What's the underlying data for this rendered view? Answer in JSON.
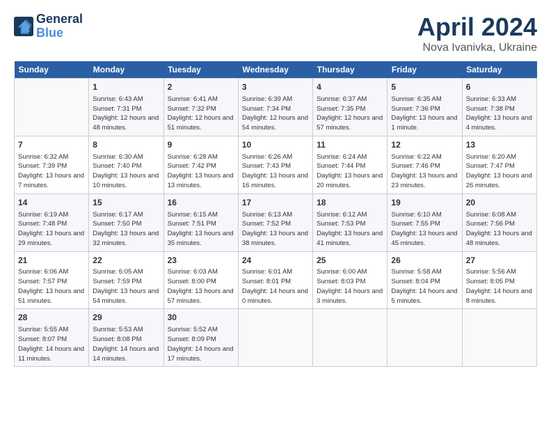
{
  "header": {
    "logo_line1": "General",
    "logo_line2": "Blue",
    "title": "April 2024",
    "subtitle": "Nova Ivanivka, Ukraine"
  },
  "days_of_week": [
    "Sunday",
    "Monday",
    "Tuesday",
    "Wednesday",
    "Thursday",
    "Friday",
    "Saturday"
  ],
  "weeks": [
    [
      {
        "day": "",
        "content": ""
      },
      {
        "day": "1",
        "content": "Sunrise: 6:43 AM\nSunset: 7:31 PM\nDaylight: 12 hours\nand 48 minutes."
      },
      {
        "day": "2",
        "content": "Sunrise: 6:41 AM\nSunset: 7:32 PM\nDaylight: 12 hours\nand 51 minutes."
      },
      {
        "day": "3",
        "content": "Sunrise: 6:39 AM\nSunset: 7:34 PM\nDaylight: 12 hours\nand 54 minutes."
      },
      {
        "day": "4",
        "content": "Sunrise: 6:37 AM\nSunset: 7:35 PM\nDaylight: 12 hours\nand 57 minutes."
      },
      {
        "day": "5",
        "content": "Sunrise: 6:35 AM\nSunset: 7:36 PM\nDaylight: 13 hours\nand 1 minute."
      },
      {
        "day": "6",
        "content": "Sunrise: 6:33 AM\nSunset: 7:38 PM\nDaylight: 13 hours\nand 4 minutes."
      }
    ],
    [
      {
        "day": "7",
        "content": "Sunrise: 6:32 AM\nSunset: 7:39 PM\nDaylight: 13 hours\nand 7 minutes."
      },
      {
        "day": "8",
        "content": "Sunrise: 6:30 AM\nSunset: 7:40 PM\nDaylight: 13 hours\nand 10 minutes."
      },
      {
        "day": "9",
        "content": "Sunrise: 6:28 AM\nSunset: 7:42 PM\nDaylight: 13 hours\nand 13 minutes."
      },
      {
        "day": "10",
        "content": "Sunrise: 6:26 AM\nSunset: 7:43 PM\nDaylight: 13 hours\nand 16 minutes."
      },
      {
        "day": "11",
        "content": "Sunrise: 6:24 AM\nSunset: 7:44 PM\nDaylight: 13 hours\nand 20 minutes."
      },
      {
        "day": "12",
        "content": "Sunrise: 6:22 AM\nSunset: 7:46 PM\nDaylight: 13 hours\nand 23 minutes."
      },
      {
        "day": "13",
        "content": "Sunrise: 6:20 AM\nSunset: 7:47 PM\nDaylight: 13 hours\nand 26 minutes."
      }
    ],
    [
      {
        "day": "14",
        "content": "Sunrise: 6:19 AM\nSunset: 7:48 PM\nDaylight: 13 hours\nand 29 minutes."
      },
      {
        "day": "15",
        "content": "Sunrise: 6:17 AM\nSunset: 7:50 PM\nDaylight: 13 hours\nand 32 minutes."
      },
      {
        "day": "16",
        "content": "Sunrise: 6:15 AM\nSunset: 7:51 PM\nDaylight: 13 hours\nand 35 minutes."
      },
      {
        "day": "17",
        "content": "Sunrise: 6:13 AM\nSunset: 7:52 PM\nDaylight: 13 hours\nand 38 minutes."
      },
      {
        "day": "18",
        "content": "Sunrise: 6:12 AM\nSunset: 7:53 PM\nDaylight: 13 hours\nand 41 minutes."
      },
      {
        "day": "19",
        "content": "Sunrise: 6:10 AM\nSunset: 7:55 PM\nDaylight: 13 hours\nand 45 minutes."
      },
      {
        "day": "20",
        "content": "Sunrise: 6:08 AM\nSunset: 7:56 PM\nDaylight: 13 hours\nand 48 minutes."
      }
    ],
    [
      {
        "day": "21",
        "content": "Sunrise: 6:06 AM\nSunset: 7:57 PM\nDaylight: 13 hours\nand 51 minutes."
      },
      {
        "day": "22",
        "content": "Sunrise: 6:05 AM\nSunset: 7:59 PM\nDaylight: 13 hours\nand 54 minutes."
      },
      {
        "day": "23",
        "content": "Sunrise: 6:03 AM\nSunset: 8:00 PM\nDaylight: 13 hours\nand 57 minutes."
      },
      {
        "day": "24",
        "content": "Sunrise: 6:01 AM\nSunset: 8:01 PM\nDaylight: 14 hours\nand 0 minutes."
      },
      {
        "day": "25",
        "content": "Sunrise: 6:00 AM\nSunset: 8:03 PM\nDaylight: 14 hours\nand 3 minutes."
      },
      {
        "day": "26",
        "content": "Sunrise: 5:58 AM\nSunset: 8:04 PM\nDaylight: 14 hours\nand 5 minutes."
      },
      {
        "day": "27",
        "content": "Sunrise: 5:56 AM\nSunset: 8:05 PM\nDaylight: 14 hours\nand 8 minutes."
      }
    ],
    [
      {
        "day": "28",
        "content": "Sunrise: 5:55 AM\nSunset: 8:07 PM\nDaylight: 14 hours\nand 11 minutes."
      },
      {
        "day": "29",
        "content": "Sunrise: 5:53 AM\nSunset: 8:08 PM\nDaylight: 14 hours\nand 14 minutes."
      },
      {
        "day": "30",
        "content": "Sunrise: 5:52 AM\nSunset: 8:09 PM\nDaylight: 14 hours\nand 17 minutes."
      },
      {
        "day": "",
        "content": ""
      },
      {
        "day": "",
        "content": ""
      },
      {
        "day": "",
        "content": ""
      },
      {
        "day": "",
        "content": ""
      }
    ]
  ]
}
